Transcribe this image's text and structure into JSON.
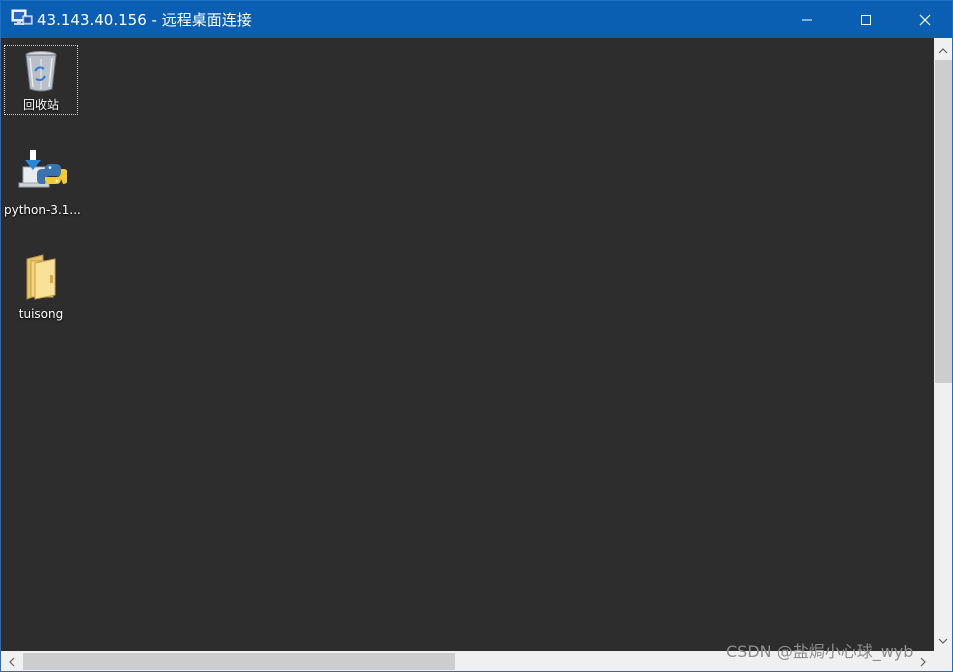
{
  "window": {
    "title": "43.143.40.156 - 远程桌面连接",
    "title_icon": "remote-desktop-icon",
    "controls": {
      "minimize_icon": "minimize-icon",
      "maximize_icon": "maximize-icon",
      "close_icon": "close-icon"
    },
    "colors": {
      "titlebar": "#0b5fb3",
      "desktop_background": "#2d2d2d"
    }
  },
  "desktop": {
    "icons": [
      {
        "label": "回收站",
        "icon": "recycle-bin-icon",
        "selected": true
      },
      {
        "label": "python-3.1...",
        "icon": "python-installer-icon",
        "selected": false
      },
      {
        "label": "tuisong",
        "icon": "folder-icon",
        "selected": false
      }
    ]
  },
  "watermark": {
    "text": "CSDN @盐焗小心球_wyb"
  }
}
